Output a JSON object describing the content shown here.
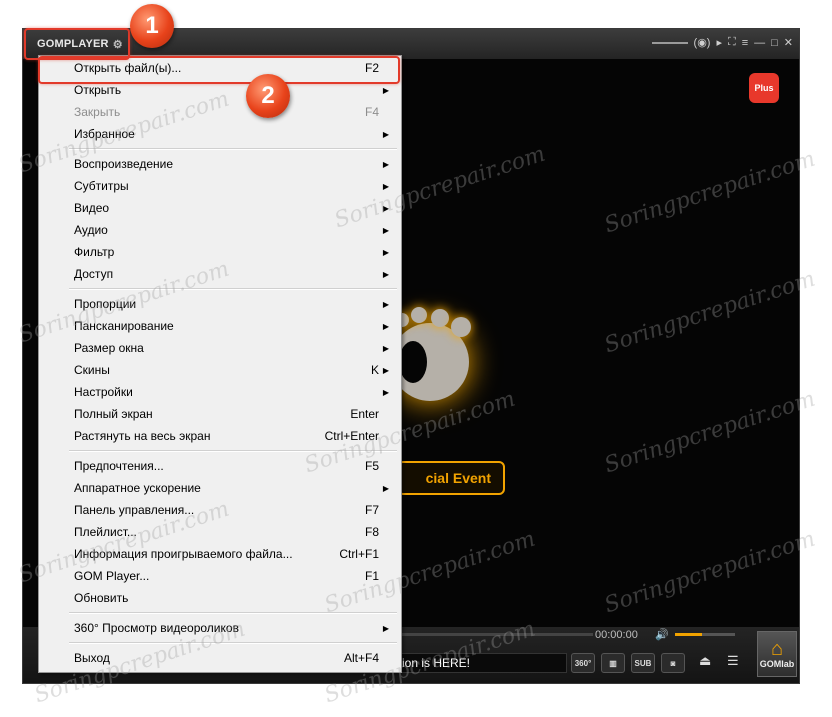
{
  "titlebar": {
    "logo": "GOMPLAYER",
    "settings_icon": "gear-icon",
    "controls": [
      "(◉)",
      "▸",
      "⛶",
      "≡",
      "—",
      "□",
      "✕"
    ]
  },
  "plus_badge": "Plus",
  "event_button": "cial Event",
  "bottom": {
    "time": "00:00:00",
    "volume_level": 0.45,
    "ticker": "rsion is HERE!",
    "btn_360": "360°",
    "btn_sub": "SUB",
    "gomlab": "GOMlab"
  },
  "menu": {
    "items": [
      {
        "label": "Открыть файл(ы)...",
        "accel": "F2",
        "arrow": "",
        "disabled": false
      },
      {
        "label": "Открыть",
        "accel": "",
        "arrow": "▶",
        "disabled": false
      },
      {
        "label": "Закрыть",
        "accel": "F4",
        "arrow": "",
        "disabled": true
      },
      {
        "label": "Избранное",
        "accel": "",
        "arrow": "▶",
        "disabled": false
      },
      {
        "label": "Воспроизведение",
        "accel": "",
        "arrow": "▶",
        "disabled": false
      },
      {
        "label": "Субтитры",
        "accel": "",
        "arrow": "▶",
        "disabled": false
      },
      {
        "label": "Видео",
        "accel": "",
        "arrow": "▶",
        "disabled": false
      },
      {
        "label": "Аудио",
        "accel": "",
        "arrow": "▶",
        "disabled": false
      },
      {
        "label": "Фильтр",
        "accel": "",
        "arrow": "▶",
        "disabled": false
      },
      {
        "label": "Доступ",
        "accel": "",
        "arrow": "▶",
        "disabled": false
      },
      {
        "label": "Пропорции",
        "accel": "",
        "arrow": "▶",
        "disabled": false
      },
      {
        "label": "Пансканирование",
        "accel": "",
        "arrow": "▶",
        "disabled": false
      },
      {
        "label": "Размер окна",
        "accel": "",
        "arrow": "▶",
        "disabled": false
      },
      {
        "label": "Скины",
        "accel": "K",
        "arrow": "▶",
        "disabled": false
      },
      {
        "label": "Настройки",
        "accel": "",
        "arrow": "▶",
        "disabled": false
      },
      {
        "label": "Полный экран",
        "accel": "Enter",
        "arrow": "",
        "disabled": false
      },
      {
        "label": "Растянуть на весь экран",
        "accel": "Ctrl+Enter",
        "arrow": "",
        "disabled": false
      },
      {
        "label": "Предпочтения...",
        "accel": "F5",
        "arrow": "",
        "disabled": false
      },
      {
        "label": "Аппаратное ускорение",
        "accel": "",
        "arrow": "▶",
        "disabled": false
      },
      {
        "label": "Панель управления...",
        "accel": "F7",
        "arrow": "",
        "disabled": false
      },
      {
        "label": "Плейлист...",
        "accel": "F8",
        "arrow": "",
        "disabled": false
      },
      {
        "label": "Информация проигрываемого файла...",
        "accel": "Ctrl+F1",
        "arrow": "",
        "disabled": false
      },
      {
        "label": "GOM Player...",
        "accel": "F1",
        "arrow": "",
        "disabled": false
      },
      {
        "label": "Обновить",
        "accel": "",
        "arrow": "",
        "disabled": false
      },
      {
        "label": "360° Просмотр видеороликов",
        "accel": "",
        "arrow": "▶",
        "disabled": false
      },
      {
        "label": "Выход",
        "accel": "Alt+F4",
        "arrow": "",
        "disabled": false
      }
    ]
  },
  "annotations": {
    "step1": "1",
    "step2": "2"
  },
  "watermark": "Soringpcrepair.com"
}
